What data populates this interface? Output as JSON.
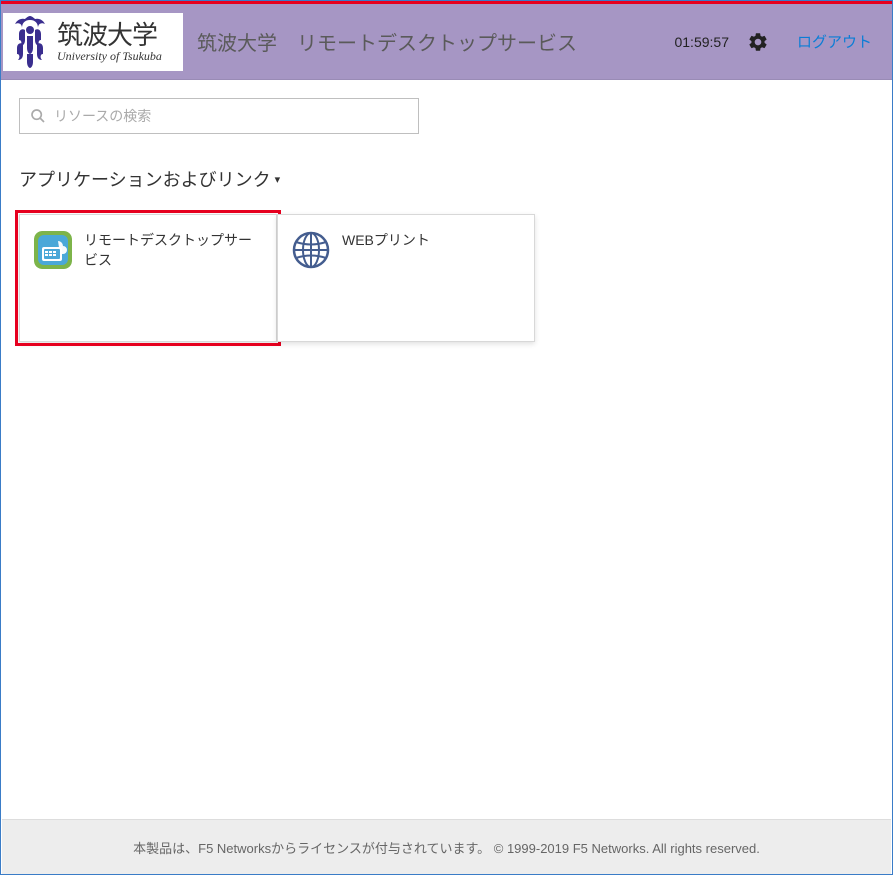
{
  "header": {
    "logo_jp": "筑波大学",
    "logo_en": "University of Tsukuba",
    "title": "筑波大学　リモートデスクトップサービス",
    "timer": "01:59:57",
    "logout_label": "ログアウト"
  },
  "search": {
    "placeholder": "リソースの検索"
  },
  "section": {
    "heading": "アプリケーションおよびリンク",
    "arrow": "▾"
  },
  "apps": [
    {
      "label": "リモートデスクトップサービス"
    },
    {
      "label": "WEBプリント"
    }
  ],
  "footer": {
    "text": "本製品は、F5 Networksからライセンスが付与されています。 © 1999-2019 F5 Networks. All rights reserved."
  }
}
